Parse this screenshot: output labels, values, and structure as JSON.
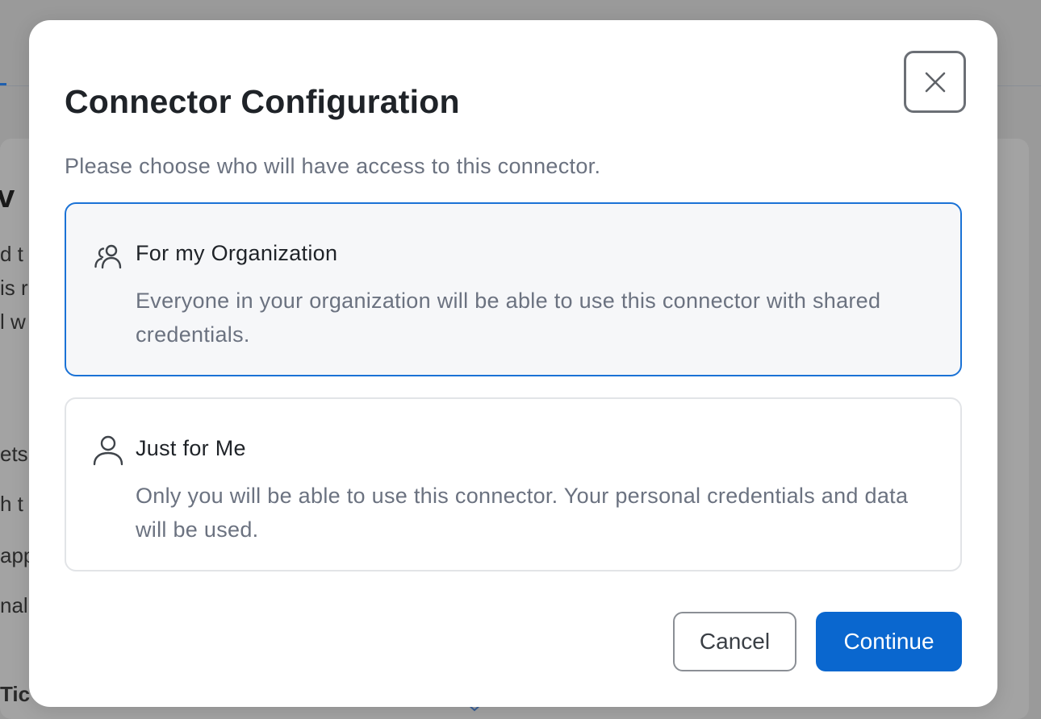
{
  "modal": {
    "title": "Connector Configuration",
    "subtitle": "Please choose who will have access to this connector.",
    "close_icon": "close-icon",
    "options": [
      {
        "icon": "users-icon",
        "title": "For my Organization",
        "description": "Everyone in your organization will be able to use this connector with shared credentials.",
        "selected": true
      },
      {
        "icon": "user-icon",
        "title": "Just for Me",
        "description": "Only you will be able to use this connector. Your personal credentials and data will be used.",
        "selected": false
      }
    ],
    "cancel_label": "Cancel",
    "continue_label": "Continue"
  },
  "background": {
    "heading_fragment": "v",
    "text_fragments": [
      "d t",
      "is r",
      "l w",
      "ets",
      "h t",
      "app",
      "nal",
      "Tic"
    ]
  },
  "colors": {
    "accent": "#0a67cf",
    "selected_border": "#1a72d6",
    "overlay": "#9c9c9c"
  }
}
